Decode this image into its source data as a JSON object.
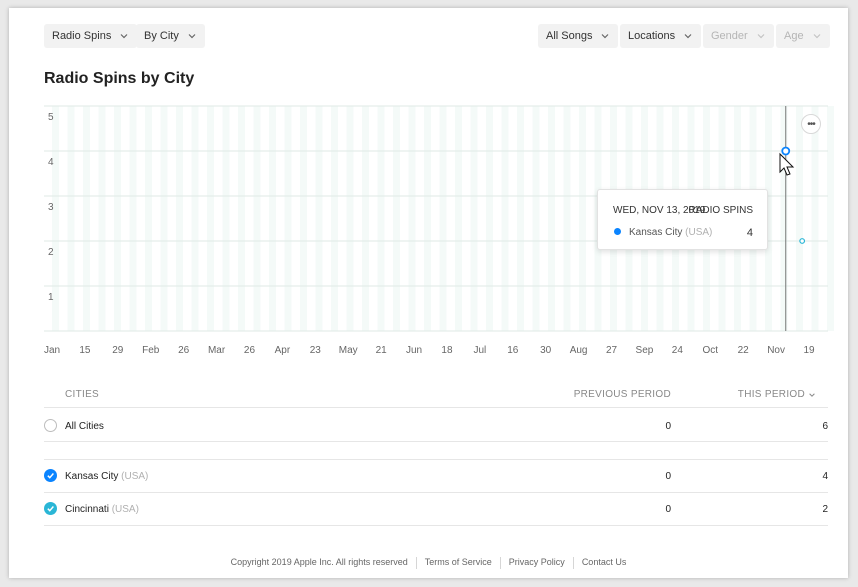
{
  "filters": {
    "metric": "Radio Spins",
    "group": "By City",
    "songs": "All Songs",
    "locations": "Locations",
    "gender": "Gender",
    "age": "Age"
  },
  "title": "Radio Spins by City",
  "more_label": "•••",
  "colors": {
    "accent": "#0a84ff",
    "secondary": "#2ab6d6"
  },
  "tooltip": {
    "date": "WED, NOV 13, 2019",
    "metric": "RADIO SPINS",
    "city": "Kansas City",
    "country": "(USA)",
    "value": "4"
  },
  "chart_data": {
    "type": "line",
    "y_ticks": [
      "5",
      "4",
      "3",
      "2",
      "1"
    ],
    "ylim": [
      0,
      5
    ],
    "x_ticks": [
      "Jan",
      "15",
      "29",
      "Feb",
      "26",
      "Mar",
      "26",
      "Apr",
      "23",
      "May",
      "21",
      "Jun",
      "18",
      "Jul",
      "16",
      "30",
      "Aug",
      "27",
      "Sep",
      "24",
      "Oct",
      "22",
      "Nov",
      "19"
    ],
    "grid": true,
    "series": [
      {
        "name": "Kansas City",
        "color": "#0a84ff",
        "points": [
          {
            "x": "2019-11-13",
            "y": 4
          }
        ]
      },
      {
        "name": "Cincinnati",
        "color": "#2ab6d6",
        "points": [
          {
            "x": "2019-11-20",
            "y": 2
          }
        ]
      }
    ]
  },
  "table": {
    "headers": {
      "cities": "CITIES",
      "previous": "PREVIOUS PERIOD",
      "this": "THIS PERIOD"
    },
    "all_row": {
      "label": "All Cities",
      "previous": "0",
      "this": "6"
    },
    "rows": [
      {
        "city": "Kansas City",
        "country": "(USA)",
        "previous": "0",
        "this": "4",
        "color": "#0a84ff"
      },
      {
        "city": "Cincinnati",
        "country": "(USA)",
        "previous": "0",
        "this": "2",
        "color": "#2ab6d6"
      }
    ]
  },
  "footer": {
    "copyright": "Copyright 2019 Apple Inc. All rights reserved",
    "terms": "Terms of Service",
    "privacy": "Privacy Policy",
    "contact": "Contact Us"
  }
}
